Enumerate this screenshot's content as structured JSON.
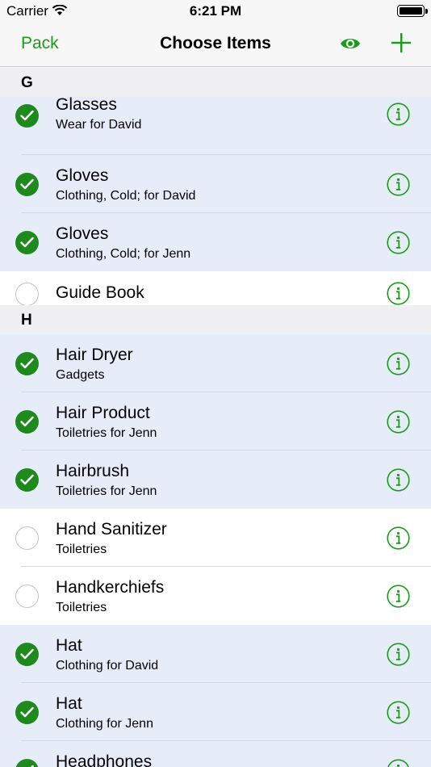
{
  "status": {
    "carrier": "Carrier",
    "time": "6:21 PM"
  },
  "nav": {
    "back": "Pack",
    "title": "Choose Items",
    "eye_icon": "eye-icon",
    "add_icon": "plus-icon"
  },
  "colors": {
    "accent": "#1a9b1a",
    "check_fill": "#1e8a1e",
    "checked_row": "#e7edf8",
    "section_bg": "#f0f0f2"
  },
  "sections": [
    {
      "letter": "G",
      "items": [
        {
          "title": "Glasses",
          "subtitle": "Wear for David",
          "checked": true
        },
        {
          "title": "Gloves",
          "subtitle": "Clothing, Cold; for David",
          "checked": true
        },
        {
          "title": "Gloves",
          "subtitle": "Clothing, Cold; for Jenn",
          "checked": true
        },
        {
          "title": "Guide Book",
          "subtitle": "",
          "checked": false
        }
      ]
    },
    {
      "letter": "H",
      "items": [
        {
          "title": "Hair Dryer",
          "subtitle": "Gadgets",
          "checked": true
        },
        {
          "title": "Hair Product",
          "subtitle": "Toiletries for Jenn",
          "checked": true
        },
        {
          "title": "Hairbrush",
          "subtitle": "Toiletries for Jenn",
          "checked": true
        },
        {
          "title": "Hand Sanitizer",
          "subtitle": "Toiletries",
          "checked": false
        },
        {
          "title": "Handkerchiefs",
          "subtitle": "Toiletries",
          "checked": false
        },
        {
          "title": "Hat",
          "subtitle": "Clothing for David",
          "checked": true
        },
        {
          "title": "Hat",
          "subtitle": "Clothing for Jenn",
          "checked": true
        },
        {
          "title": "Headphones",
          "subtitle": "",
          "checked": true
        }
      ]
    }
  ]
}
